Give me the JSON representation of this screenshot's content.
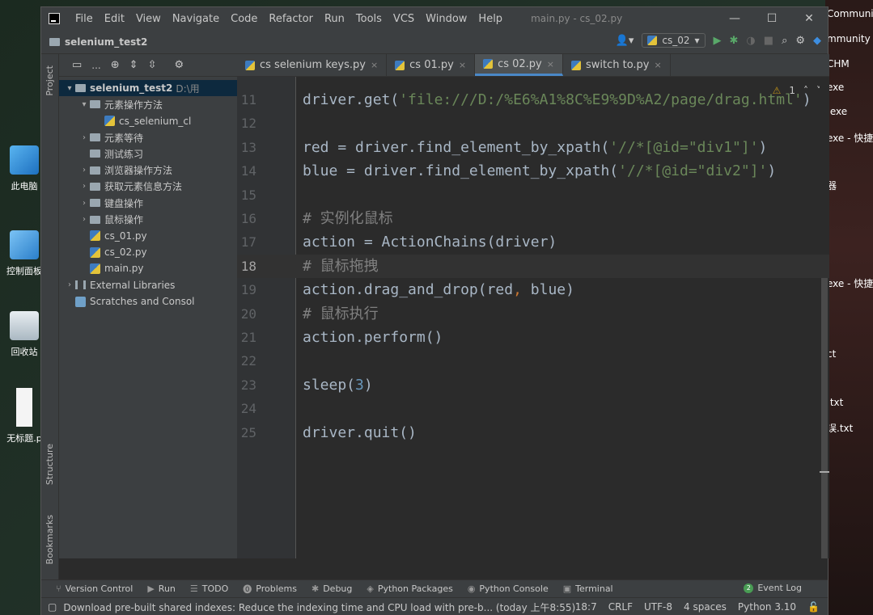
{
  "desktop": {
    "icons": [
      {
        "label": "此电脑"
      },
      {
        "label": "控制面板"
      },
      {
        "label": "回收站"
      },
      {
        "label": "无标题.p"
      }
    ],
    "right_items": [
      "Communi",
      "mmunity I",
      "CHM",
      "exe",
      ".exe",
      "exe - 快捷方",
      "器",
      "exe - 快捷方",
      "ct",
      ".txt",
      "误.txt"
    ]
  },
  "titlebar": {
    "menu": [
      "File",
      "Edit",
      "View",
      "Navigate",
      "Code",
      "Refactor",
      "Run",
      "Tools",
      "VCS",
      "Window",
      "Help"
    ],
    "window_title": "main.py - cs_02.py",
    "minimize": "—",
    "maximize": "☐",
    "close": "✕"
  },
  "navbar": {
    "project_name": "selenium_test2",
    "run_config": "cs_02"
  },
  "side_tabs": {
    "project": "Project",
    "structure": "Structure",
    "bookmarks": "Bookmarks"
  },
  "project_panel": {
    "header": "...",
    "tree": [
      {
        "label": "selenium_test2",
        "path": "D:\\用",
        "level": 0,
        "arrow": "▾",
        "type": "folder",
        "selected": true
      },
      {
        "label": "元素操作方法",
        "level": 1,
        "arrow": "▾",
        "type": "folder"
      },
      {
        "label": "cs_selenium_cl",
        "level": 2,
        "arrow": "",
        "type": "py"
      },
      {
        "label": "元素等待",
        "level": 1,
        "arrow": "›",
        "type": "folder"
      },
      {
        "label": "测试练习",
        "level": 1,
        "arrow": "",
        "type": "folder"
      },
      {
        "label": "浏览器操作方法",
        "level": 1,
        "arrow": "›",
        "type": "folder"
      },
      {
        "label": "获取元素信息方法",
        "level": 1,
        "arrow": "›",
        "type": "folder"
      },
      {
        "label": "键盘操作",
        "level": 1,
        "arrow": "›",
        "type": "folder"
      },
      {
        "label": "鼠标操作",
        "level": 1,
        "arrow": "›",
        "type": "folder"
      },
      {
        "label": "cs_01.py",
        "level": 1,
        "arrow": "",
        "type": "py"
      },
      {
        "label": "cs_02.py",
        "level": 1,
        "arrow": "",
        "type": "py"
      },
      {
        "label": "main.py",
        "level": 1,
        "arrow": "",
        "type": "py"
      },
      {
        "label": "External Libraries",
        "level": 0,
        "arrow": "›",
        "type": "lib"
      },
      {
        "label": "Scratches and Consol",
        "level": 0,
        "arrow": "",
        "type": "scratch"
      }
    ]
  },
  "tabs": [
    {
      "label": "cs selenium keys.py",
      "active": false
    },
    {
      "label": "cs 01.py",
      "active": false
    },
    {
      "label": "cs 02.py",
      "active": true
    },
    {
      "label": "switch to.py",
      "active": false
    }
  ],
  "editor": {
    "inspection_count": "1",
    "current_line": 18,
    "lines": [
      {
        "n": "11",
        "segs": [
          {
            "t": "driver.get(",
            "c": ""
          },
          {
            "t": "'file:///D:/%E6%A1%8C%E9%9D%A2/page/drag.html'",
            "c": "str"
          },
          {
            "t": ")",
            "c": ""
          }
        ]
      },
      {
        "n": "12",
        "segs": []
      },
      {
        "n": "13",
        "segs": [
          {
            "t": "red = driver.find_element_by_xpath(",
            "c": ""
          },
          {
            "t": "'//*[@id=\"div1\"]'",
            "c": "str"
          },
          {
            "t": ")",
            "c": ""
          }
        ]
      },
      {
        "n": "14",
        "segs": [
          {
            "t": "blue = driver.find_element_by_xpath(",
            "c": ""
          },
          {
            "t": "'//*[@id=\"div2\"]'",
            "c": "str"
          },
          {
            "t": ")",
            "c": ""
          }
        ]
      },
      {
        "n": "15",
        "segs": []
      },
      {
        "n": "16",
        "segs": [
          {
            "t": "# 实例化鼠标",
            "c": "cmt"
          }
        ]
      },
      {
        "n": "17",
        "segs": [
          {
            "t": "action = ActionChains(driver)",
            "c": ""
          }
        ]
      },
      {
        "n": "18",
        "segs": [
          {
            "t": "# 鼠标拖拽",
            "c": "cmt"
          }
        ]
      },
      {
        "n": "19",
        "segs": [
          {
            "t": "action.drag_and_drop(red",
            "c": ""
          },
          {
            "t": ", ",
            "c": "op"
          },
          {
            "t": "blue)",
            "c": ""
          }
        ]
      },
      {
        "n": "20",
        "segs": [
          {
            "t": "# 鼠标执行",
            "c": "cmt"
          }
        ]
      },
      {
        "n": "21",
        "segs": [
          {
            "t": "action.perform()",
            "c": ""
          }
        ]
      },
      {
        "n": "22",
        "segs": []
      },
      {
        "n": "23",
        "segs": [
          {
            "t": "sleep(",
            "c": ""
          },
          {
            "t": "3",
            "c": "num"
          },
          {
            "t": ")",
            "c": ""
          }
        ]
      },
      {
        "n": "24",
        "segs": []
      },
      {
        "n": "25",
        "segs": [
          {
            "t": "driver.quit()",
            "c": ""
          }
        ]
      }
    ]
  },
  "bottom_tools": [
    {
      "icon": "⑂",
      "label": "Version Control"
    },
    {
      "icon": "▶",
      "label": "Run"
    },
    {
      "icon": "☰",
      "label": "TODO"
    },
    {
      "icon": "⓿",
      "label": "Problems"
    },
    {
      "icon": "✱",
      "label": "Debug"
    },
    {
      "icon": "◈",
      "label": "Python Packages"
    },
    {
      "icon": "◉",
      "label": "Python Console"
    },
    {
      "icon": "▣",
      "label": "Terminal"
    }
  ],
  "event_log": {
    "badge": "2",
    "label": "Event Log"
  },
  "statusbar": {
    "message": "Download pre-built shared indexes: Reduce the indexing time and CPU load with pre-b... (today 上午8:55)",
    "position": "18:7",
    "line_sep": "CRLF",
    "encoding": "UTF-8",
    "indent": "4 spaces",
    "interpreter": "Python 3.10"
  },
  "colors": {
    "accent": "#4a88c7",
    "background": "#2b2b2b",
    "panel": "#3c3f41",
    "string": "#6a8759",
    "comment": "#808080",
    "number": "#6897bb"
  }
}
